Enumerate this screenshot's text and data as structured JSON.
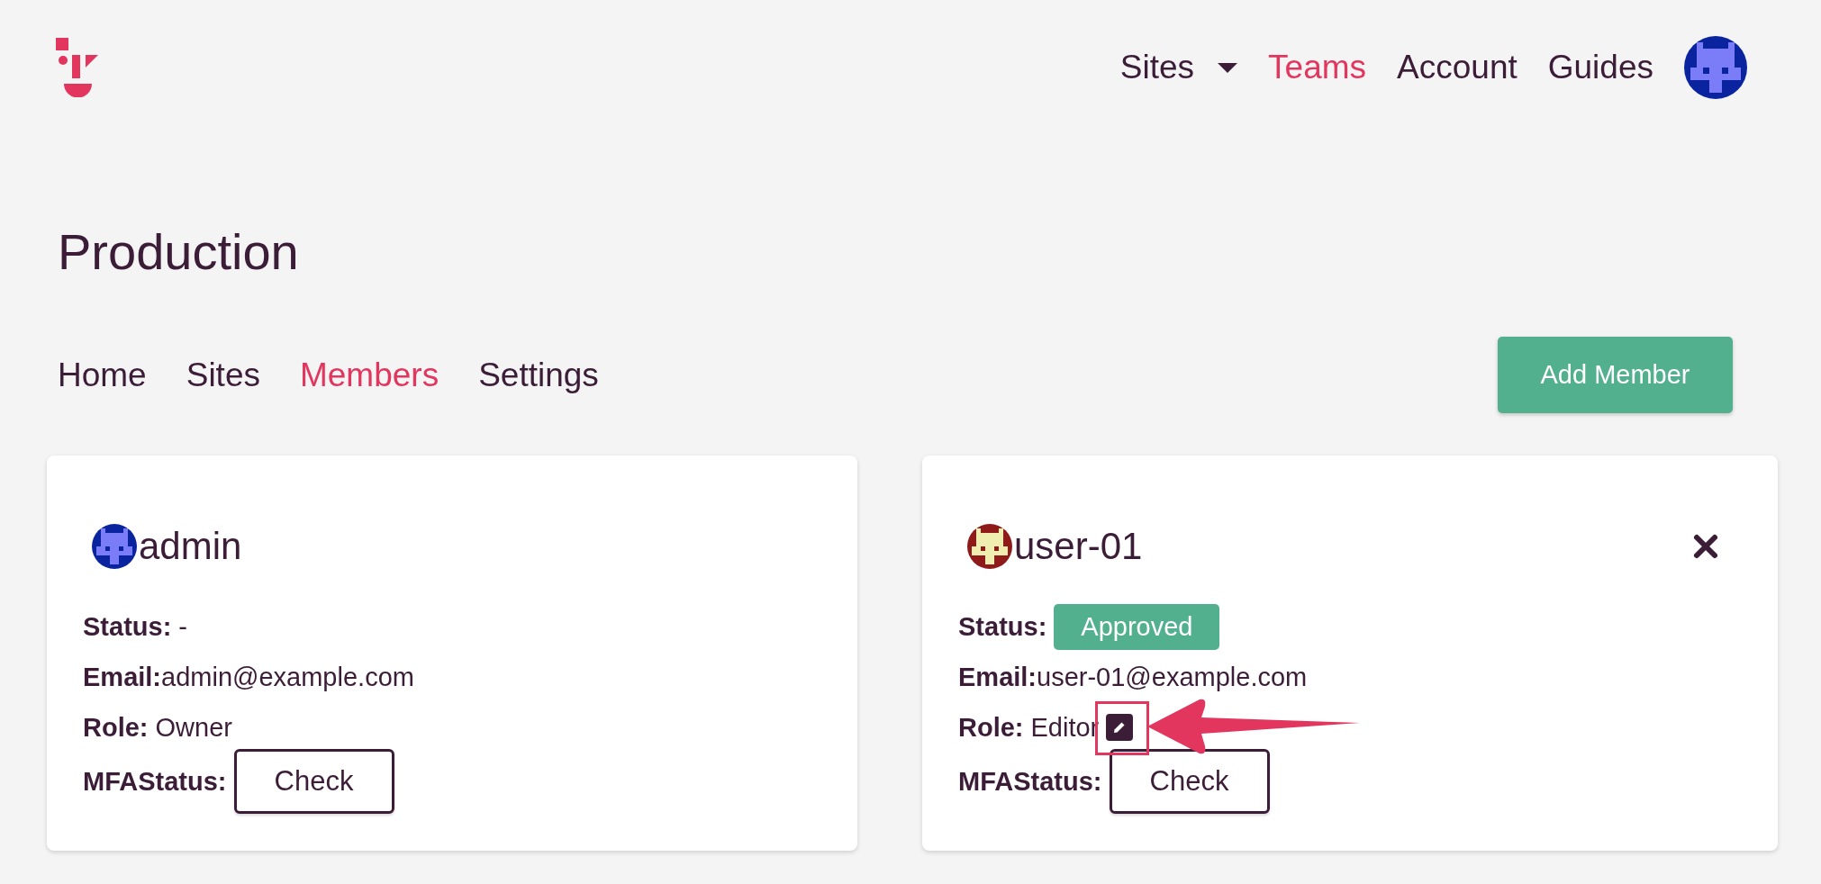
{
  "nav": {
    "items": [
      {
        "label": "Sites",
        "selected": false,
        "has_menu": true
      },
      {
        "label": "Teams",
        "selected": true,
        "has_menu": false
      },
      {
        "label": "Account",
        "selected": false,
        "has_menu": false
      },
      {
        "label": "Guides",
        "selected": false,
        "has_menu": false
      }
    ]
  },
  "page_title": "Production",
  "tabs": [
    {
      "label": "Home",
      "selected": false
    },
    {
      "label": "Sites",
      "selected": false
    },
    {
      "label": "Members",
      "selected": true
    },
    {
      "label": "Settings",
      "selected": false
    }
  ],
  "add_button": "Add Member",
  "members": [
    {
      "name": "admin",
      "color": "#0a24a0",
      "removable": false,
      "status_label": "Status:",
      "status": {
        "kind": "text",
        "text": "-"
      },
      "email_label": "Email:",
      "email": "admin@example.com",
      "role_label": "Role:",
      "role": "Owner",
      "role_editable": false,
      "mfa_label": "MFAStatus:",
      "mfa_button": "Check"
    },
    {
      "name": "user-01",
      "color": "#8e1a1a",
      "removable": true,
      "status_label": "Status:",
      "status": {
        "kind": "badge",
        "text": "Approved"
      },
      "email_label": "Email:",
      "email": "user-01@example.com",
      "role_label": "Role:",
      "role": "Editor",
      "role_editable": true,
      "mfa_label": "MFAStatus:",
      "mfa_button": "Check"
    }
  ]
}
